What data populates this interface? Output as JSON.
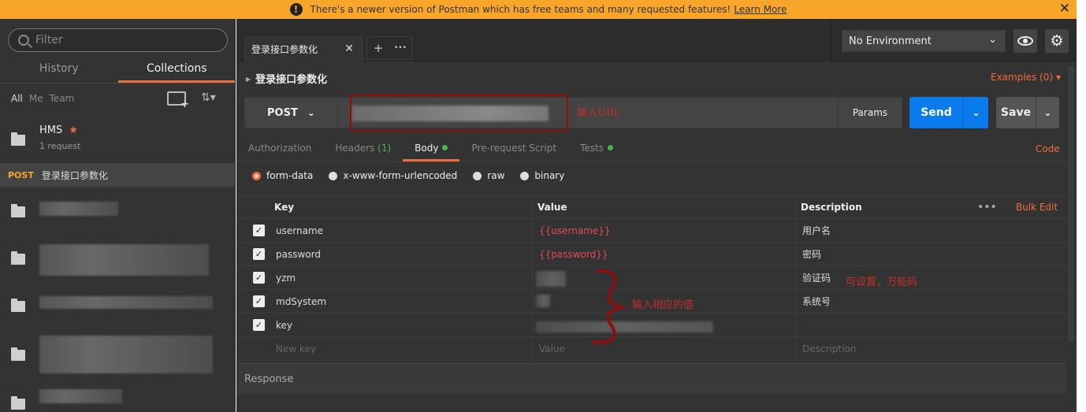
{
  "banner": {
    "message": "There's a newer version of Postman which has free teams and many requested features!",
    "link": "Learn More",
    "close": "✕"
  },
  "sidebar": {
    "filter_placeholder": "Filter",
    "tabs": [
      "History",
      "Collections"
    ],
    "filters": [
      "All",
      "Me",
      "Team"
    ],
    "collection": {
      "name": "HMS",
      "sub": "1 request"
    },
    "request": {
      "method": "POST",
      "name": "登录接口参数化"
    }
  },
  "tabbar": {
    "tab_label": "登录接口参数化",
    "tab_close": "✕",
    "add": "+",
    "more": "•••",
    "environment": "No Environment"
  },
  "request": {
    "title": "登录接口参数化",
    "examples": "Examples (0)",
    "method": "POST",
    "url_annotation": "输入URL",
    "params": "Params",
    "send": "Send",
    "save": "Save",
    "code": "Code",
    "tabs": [
      {
        "label": "Authorization"
      },
      {
        "label": "Headers",
        "count": "(1)"
      },
      {
        "label": "Body",
        "dot": true
      },
      {
        "label": "Pre-request Script"
      },
      {
        "label": "Tests",
        "dot": true
      }
    ],
    "body_types": [
      "form-data",
      "x-www-form-urlencoded",
      "raw",
      "binary"
    ]
  },
  "kv_table": {
    "headers": {
      "key": "Key",
      "value": "Value",
      "description": "Description",
      "more": "•••",
      "bulk": "Bulk Edit"
    },
    "rows": [
      {
        "key": "username",
        "value": "{{username}}",
        "description": "用户名"
      },
      {
        "key": "password",
        "value": "{{password}}",
        "description": "密码"
      },
      {
        "key": "yzm",
        "value": "",
        "description": "验证码"
      },
      {
        "key": "mdSystem",
        "value": "",
        "description": "系统号"
      },
      {
        "key": "key",
        "value": "",
        "description": ""
      }
    ],
    "new_row": {
      "key": "New key",
      "value": "Value",
      "description": "Description"
    },
    "brace_annotation": "输入相应的值",
    "yzm_annotation": "可设置，万能码"
  },
  "response": {
    "label": "Response"
  },
  "colors": {
    "accent": "#f26b3a",
    "send": "#097bed",
    "banner": "#f8a62a",
    "annotation": "#c0302a",
    "variable": "#e5485a"
  }
}
